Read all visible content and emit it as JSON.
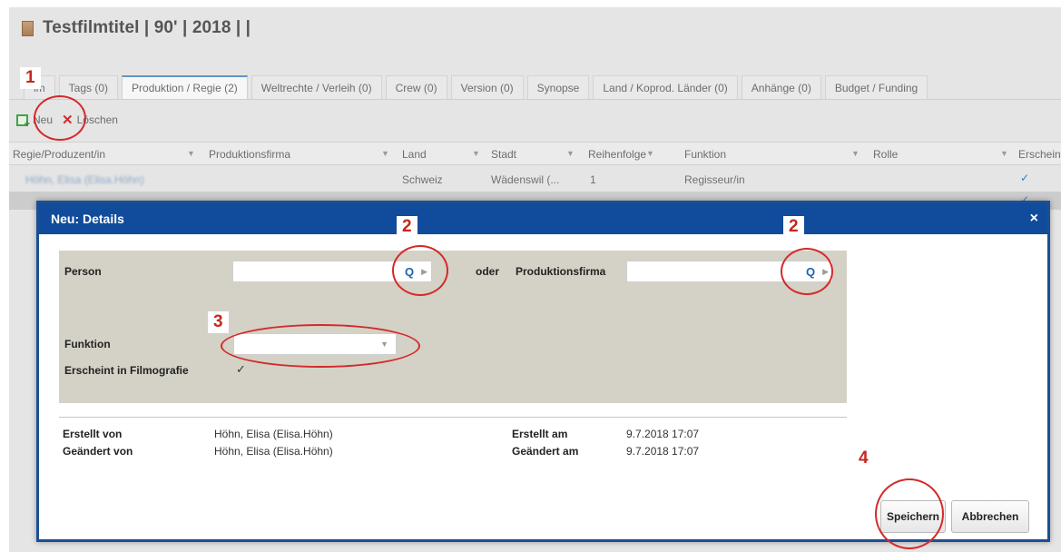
{
  "header": {
    "title": "Testfilmtitel | 90' | 2018 |  |"
  },
  "tabs": [
    {
      "label": "lm"
    },
    {
      "label": "Tags (0)"
    },
    {
      "label": "Produktion / Regie (2)"
    },
    {
      "label": "Weltrechte / Verleih (0)"
    },
    {
      "label": "Crew (0)"
    },
    {
      "label": "Version (0)"
    },
    {
      "label": "Synopse"
    },
    {
      "label": "Land / Koprod. Länder (0)"
    },
    {
      "label": "Anhänge (0)"
    },
    {
      "label": "Budget / Funding"
    }
  ],
  "toolbar": {
    "new_label": "Neu",
    "delete_label": "Löschen"
  },
  "grid": {
    "columns": [
      "Regie/Produzent/in",
      "Produktionsfirma",
      "Land",
      "Stadt",
      "Reihenfolge",
      "Funktion",
      "Rolle",
      "Erscheint"
    ],
    "rows": [
      {
        "name": "Höhn, Elisa (Elisa.Höhn)",
        "firma": "",
        "land": "Schweiz",
        "stadt": "Wädenswil (...",
        "reihenfolge": "1",
        "funktion": "Regisseur/in",
        "rolle": "",
        "erscheint": "✓"
      }
    ]
  },
  "dialog": {
    "title": "Neu: Details",
    "close": "×",
    "person_label": "Person",
    "person_value": "",
    "or_label": "oder",
    "firma_label": "Produktionsfirma",
    "firma_value": "",
    "funktion_label": "Funktion",
    "funktion_value": "",
    "filmografie_label": "Erscheint in Filmografie",
    "filmografie_checked": "✓",
    "created_by_label": "Erstellt von",
    "created_by_value": "Höhn, Elisa (Elisa.Höhn)",
    "changed_by_label": "Geändert von",
    "changed_by_value": "Höhn, Elisa (Elisa.Höhn)",
    "created_at_label": "Erstellt am",
    "created_at_value": "9.7.2018 17:07",
    "changed_at_label": "Geändert am",
    "changed_at_value": "9.7.2018 17:07",
    "save_label": "Speichern",
    "cancel_label": "Abbrechen"
  },
  "annotations": {
    "n1": "1",
    "n2a": "2",
    "n2b": "2",
    "n3": "3",
    "n4": "4"
  },
  "icons": {
    "film": "film-icon",
    "new": "new-icon",
    "delete": "delete-icon",
    "search": "search-icon",
    "expand": "triangle-right-icon",
    "dropdown": "chevron-down-icon",
    "check": "check-icon"
  },
  "colors": {
    "dialog_header": "#114b9c",
    "annotation": "#c3281f",
    "search_icon": "#1f62b3",
    "form_bg": "#d4d1c6"
  }
}
